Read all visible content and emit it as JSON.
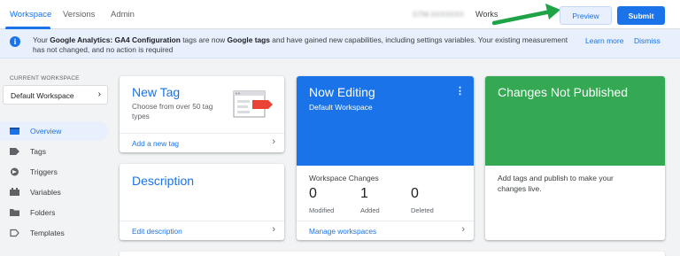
{
  "topbar": {
    "tabs": [
      "Workspace",
      "Versions",
      "Admin"
    ],
    "container_id": "GTM-XXXXXXX",
    "workspace_label": "Workspace",
    "preview_label": "Preview",
    "submit_label": "Submit"
  },
  "banner": {
    "text_pre": "Your ",
    "bold_1": "Google Analytics: GA4 Configuration",
    "text_mid": " tags are now ",
    "bold_2": "Google tags",
    "text_post": " and have gained new capabilities, including settings variables. Your existing measurement has not changed, and no action is required",
    "learn_more": "Learn more",
    "dismiss": "Dismiss"
  },
  "sidebar": {
    "current_workspace_label": "CURRENT WORKSPACE",
    "workspace_name": "Default Workspace",
    "items": [
      {
        "label": "Overview",
        "icon": "overview-icon"
      },
      {
        "label": "Tags",
        "icon": "tag-icon"
      },
      {
        "label": "Triggers",
        "icon": "trigger-icon"
      },
      {
        "label": "Variables",
        "icon": "variables-icon"
      },
      {
        "label": "Folders",
        "icon": "folder-icon"
      },
      {
        "label": "Templates",
        "icon": "template-icon"
      }
    ]
  },
  "cards": {
    "new_tag": {
      "title": "New Tag",
      "subtitle_line1": "Choose from over 50 tag",
      "subtitle_line2": "types",
      "link": "Add a new tag"
    },
    "description": {
      "title": "Description",
      "link": "Edit description"
    },
    "now_editing": {
      "title": "Now Editing",
      "subtitle": "Default Workspace",
      "changes_label": "Workspace Changes",
      "stats": [
        {
          "value": "0",
          "label": "Modified"
        },
        {
          "value": "1",
          "label": "Added"
        },
        {
          "value": "0",
          "label": "Deleted"
        }
      ],
      "link": "Manage workspaces"
    },
    "changes_not_published": {
      "title": "Changes Not Published",
      "text": "Add tags and publish to make your changes live."
    }
  },
  "colors": {
    "accent": "#1a73e8",
    "green": "#34a853",
    "banner_bg": "#e8f0fe",
    "arrow": "#1ea446"
  }
}
